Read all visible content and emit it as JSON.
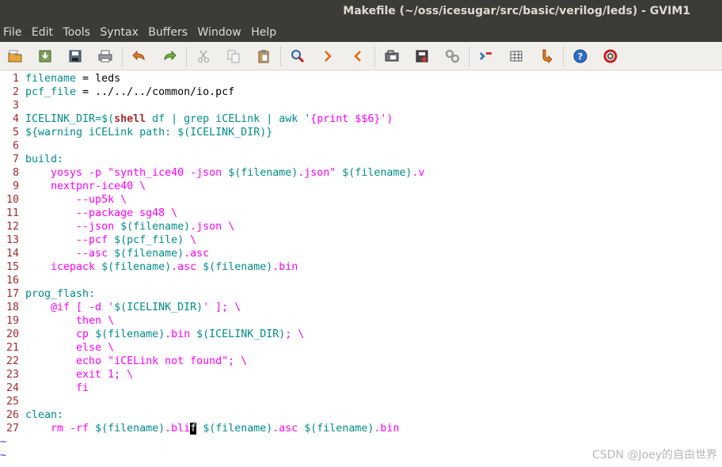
{
  "window": {
    "title": "Makefile (~/oss/icesugar/src/basic/verilog/leds) - GVIM1"
  },
  "menu": [
    "File",
    "Edit",
    "Tools",
    "Syntax",
    "Buffers",
    "Window",
    "Help"
  ],
  "toolbar": [
    "open-icon",
    "save-down-icon",
    "save-icon",
    "print-icon",
    "undo-icon",
    "redo-icon",
    "cut-icon",
    "copy-icon",
    "paste-icon",
    "find-replace-icon",
    "find-next-icon",
    "find-prev-icon",
    "load-session-icon",
    "save-session-icon",
    "run-script-icon",
    "make-icon",
    "build-tags-icon",
    "jump-tag-icon",
    "help-icon",
    "find-help-icon"
  ],
  "editor": {
    "lines": [
      [
        "filename",
        " = leds"
      ],
      [
        "pcf_file",
        " = ../../../common/io.pcf"
      ],
      [
        ""
      ],
      [
        "ICELINK_DIR",
        "=$(",
        "shell",
        " df | grep iCELink | awk '",
        "{print $$6}",
        "')"
      ],
      [
        "${warning iCELink path: $(ICELINK_DIR)}"
      ],
      [
        ""
      ],
      [
        "build:"
      ],
      [
        "    yosys -p \"synth_ice40 -json ",
        "$(filename)",
        ".json\" ",
        "$(filename)",
        ".v"
      ],
      [
        "    nextpnr-ice40 \\"
      ],
      [
        "        --up5k \\"
      ],
      [
        "        --package sg48 \\"
      ],
      [
        "        --json ",
        "$(filename)",
        ".json \\"
      ],
      [
        "        --pcf ",
        "$(pcf_file)",
        " \\"
      ],
      [
        "        --asc ",
        "$(filename)",
        ".asc"
      ],
      [
        "    icepack ",
        "$(filename)",
        ".asc ",
        "$(filename)",
        ".bin"
      ],
      [
        ""
      ],
      [
        "prog_flash:"
      ],
      [
        "    @if [ -d '",
        "$(ICELINK_DIR)",
        "' ]; \\"
      ],
      [
        "        then \\"
      ],
      [
        "        cp ",
        "$(filename)",
        ".bin ",
        "$(ICELINK_DIR)",
        "; \\"
      ],
      [
        "        else \\"
      ],
      [
        "        echo \"iCELink not found\"; \\"
      ],
      [
        "        exit 1; \\"
      ],
      [
        "        fi"
      ],
      [
        ""
      ],
      [
        "clean:"
      ],
      [
        "    rm -rf ",
        "$(filename)",
        ".bli",
        "f",
        " ",
        "$(filename)",
        ".asc ",
        "$(filename)",
        ".bin"
      ]
    ],
    "tilde_lines": [
      "~",
      "~"
    ]
  },
  "watermark": "CSDN @Joey的自由世界",
  "colors": {
    "line_number": "#a52a2a",
    "identifier": "#008b8b",
    "string": "#ff00ff",
    "keyword": "#a52a2a",
    "tilde": "#2b2bff",
    "titlebar_bg": "#3c3b37",
    "toolbar_bg": "#f0efec"
  }
}
